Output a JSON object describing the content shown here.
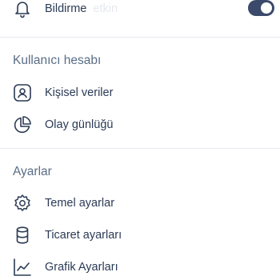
{
  "notifications": {
    "label": "Bildirme",
    "faded_suffix": "etkin",
    "toggle_on": true,
    "icon": "bell-icon"
  },
  "account_section": {
    "title": "Kullanıcı hesabı",
    "items": [
      {
        "label": "Kişisel veriler",
        "icon": "user-card-icon"
      },
      {
        "label": "Olay günlüğü",
        "icon": "pie-chart-icon"
      }
    ]
  },
  "settings_section": {
    "title": "Ayarlar",
    "items": [
      {
        "label": "Temel ayarlar",
        "icon": "gear-icon"
      },
      {
        "label": "Ticaret ayarları",
        "icon": "database-icon"
      },
      {
        "label": "Grafik Ayarları",
        "icon": "line-chart-icon"
      }
    ]
  },
  "colors": {
    "text": "#2b3a55",
    "section_title": "#5a6d86",
    "toggle_bg": "#3b4a6b",
    "divider": "#e7eaf0"
  }
}
